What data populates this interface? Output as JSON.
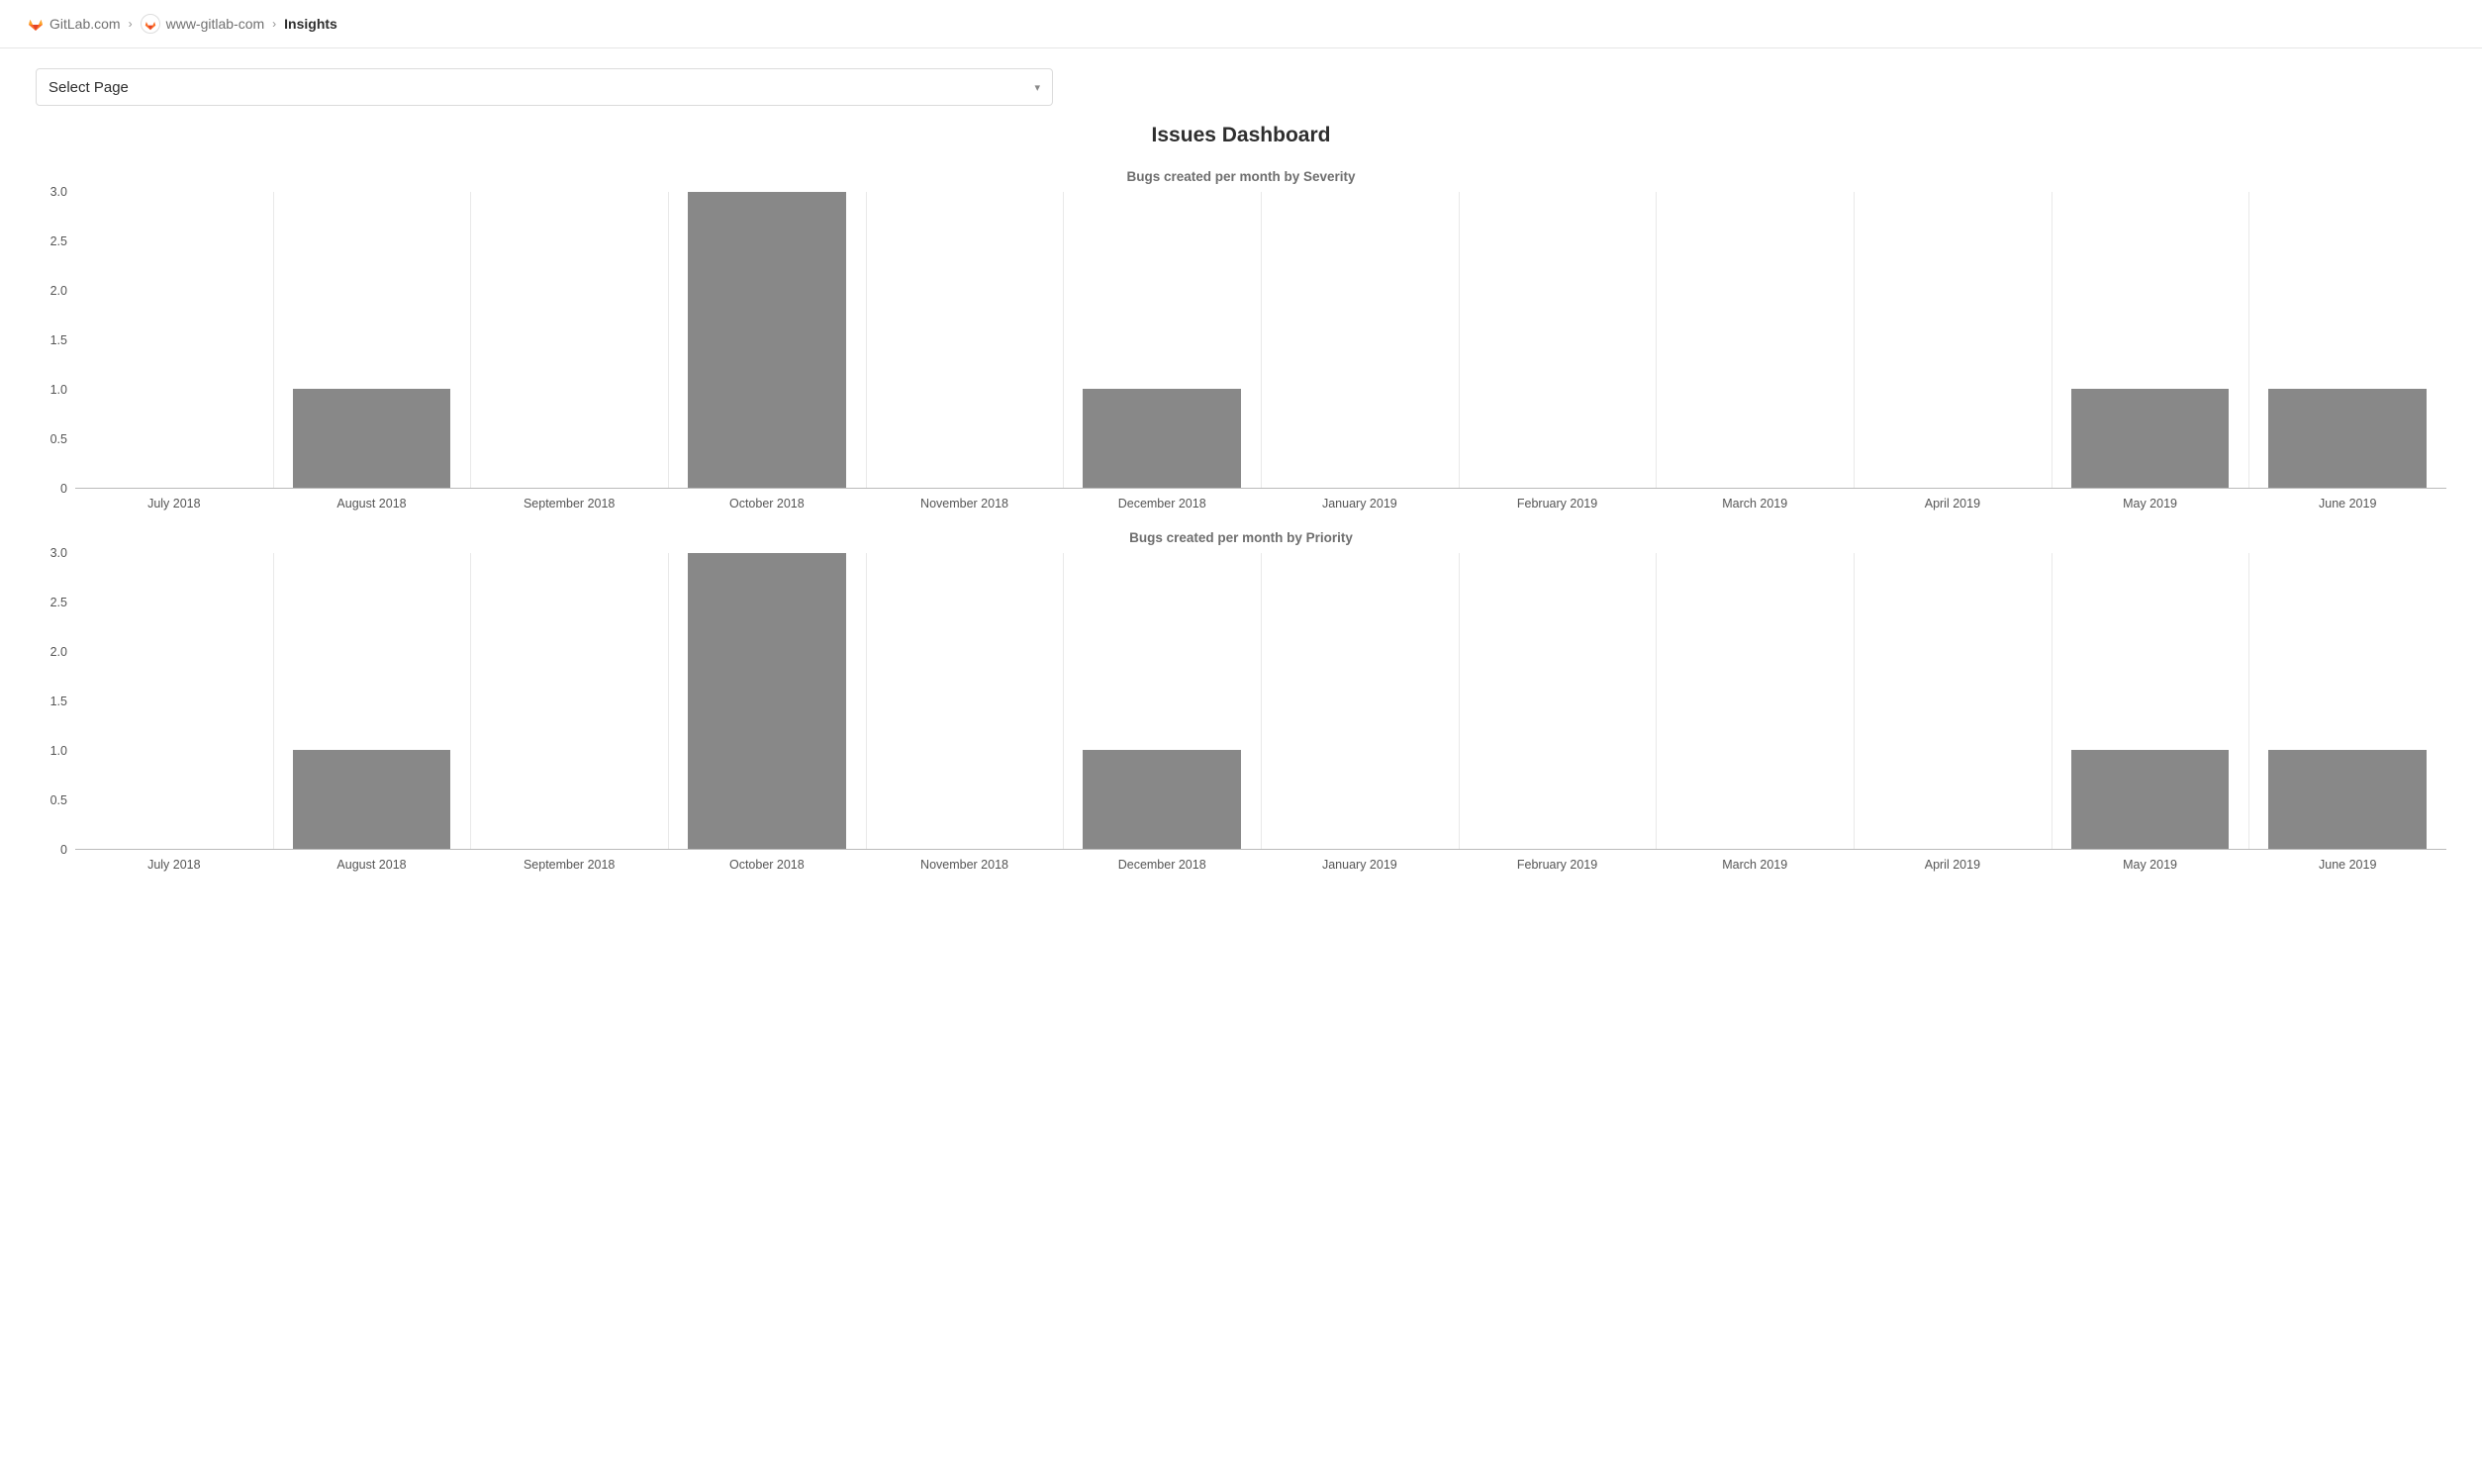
{
  "breadcrumb": {
    "items": [
      {
        "label": "GitLab.com",
        "has_gitlab_icon": true
      },
      {
        "label": "www-gitlab-com",
        "has_avatar": true
      }
    ],
    "current": "Insights"
  },
  "select": {
    "label": "Select Page"
  },
  "dashboard_title": "Issues Dashboard",
  "chart_data": [
    {
      "type": "bar",
      "title": "Bugs created per month by Severity",
      "categories": [
        "July 2018",
        "August 2018",
        "September 2018",
        "October 2018",
        "November 2018",
        "December 2018",
        "January 2019",
        "February 2019",
        "March 2019",
        "April 2019",
        "May 2019",
        "June 2019"
      ],
      "values": [
        0,
        1,
        0,
        3,
        0,
        1,
        0,
        0,
        0,
        0,
        1,
        1
      ],
      "ylim": [
        0,
        3
      ],
      "y_ticks": [
        0,
        0.5,
        1.0,
        1.5,
        2.0,
        2.5,
        3.0
      ],
      "y_tick_labels": [
        "0",
        "0.5",
        "1.0",
        "1.5",
        "2.0",
        "2.5",
        "3.0"
      ],
      "xlabel": "",
      "ylabel": ""
    },
    {
      "type": "bar",
      "title": "Bugs created per month by Priority",
      "categories": [
        "July 2018",
        "August 2018",
        "September 2018",
        "October 2018",
        "November 2018",
        "December 2018",
        "January 2019",
        "February 2019",
        "March 2019",
        "April 2019",
        "May 2019",
        "June 2019"
      ],
      "values": [
        0,
        1,
        0,
        3,
        0,
        1,
        0,
        0,
        0,
        0,
        1,
        1
      ],
      "ylim": [
        0,
        3
      ],
      "y_ticks": [
        0,
        0.5,
        1.0,
        1.5,
        2.0,
        2.5,
        3.0
      ],
      "y_tick_labels": [
        "0",
        "0.5",
        "1.0",
        "1.5",
        "2.0",
        "2.5",
        "3.0"
      ],
      "xlabel": "",
      "ylabel": ""
    }
  ],
  "colors": {
    "bar": "#888888",
    "grid": "#e9e9e9",
    "border": "#dbdbdb"
  }
}
